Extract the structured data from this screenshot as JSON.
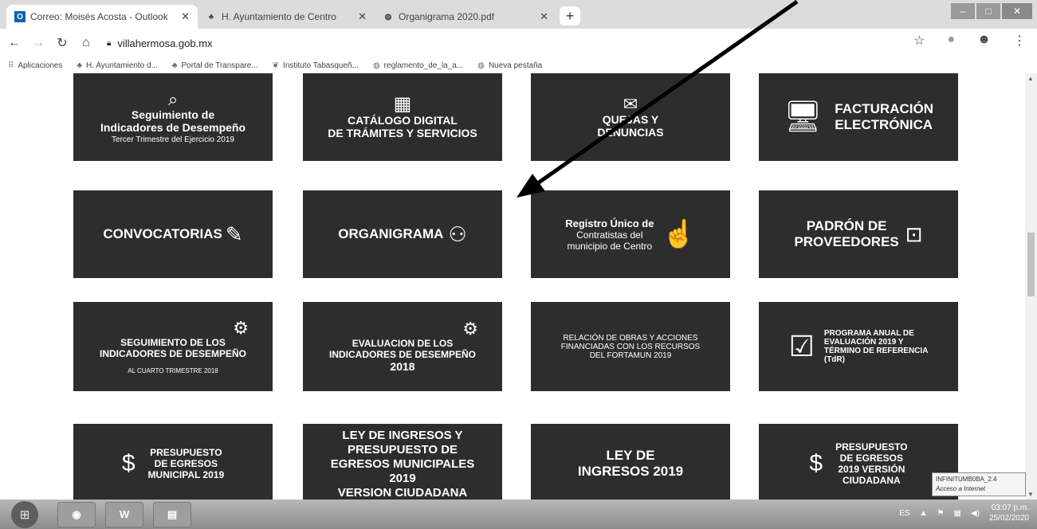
{
  "browser": {
    "tabs": [
      {
        "title": "Correo: Moisés Acosta - Outlook",
        "favicon": "outlook-icon",
        "active": true
      },
      {
        "title": "H. Ayuntamiento de Centro",
        "favicon": "palm-icon",
        "active": false
      },
      {
        "title": "Organigrama 2020.pdf",
        "favicon": "globe-icon",
        "active": false
      }
    ],
    "new_tab_label": "+",
    "url": "villahermosa.gob.mx",
    "bookmarks": [
      {
        "label": "Aplicaciones",
        "icon": "apps-grid-icon"
      },
      {
        "label": "H. Ayuntamiento d...",
        "icon": "palm-icon"
      },
      {
        "label": "Portal de Transpare...",
        "icon": "palm-icon"
      },
      {
        "label": "Instituto Tabasqueñ...",
        "icon": "leaf-icon"
      },
      {
        "label": "reglamento_de_la_a...",
        "icon": "globe-icon"
      },
      {
        "label": "Nueva pestaña",
        "icon": "globe-icon"
      }
    ]
  },
  "tiles": {
    "r1": {
      "seguimiento": {
        "line1": "Seguimiento de",
        "line2": "Indicadores de Desempeño",
        "line3": "Tercer Trimestre del Ejercicio 2019"
      },
      "catalogo": {
        "line1": "CATÁLOGO DIGITAL",
        "line2": "DE TRÁMITES Y SERVICIOS"
      },
      "quejas": {
        "line1": "QUEJAS Y",
        "line2": "DENUNCIAS"
      },
      "facturacion": {
        "line1": "FACTURACIÓN",
        "line2": "ELECTRÓNICA"
      }
    },
    "r2": {
      "convocatorias": {
        "label": "CONVOCATORIAS"
      },
      "organigrama": {
        "label": "ORGANIGRAMA"
      },
      "registro": {
        "line1": "Registro Único de",
        "line2": "Contratistas del",
        "line3": "municipio de Centro"
      },
      "padron": {
        "line1": "PADRÓN DE",
        "line2": "PROVEEDORES"
      }
    },
    "r3": {
      "seguimiento_ind": {
        "line1": "SEGUIMIENTO DE LOS",
        "line2": "INDICADORES DE DESEMPEÑO",
        "line3": "AL CUARTO TRIMESTRE 2018"
      },
      "evaluacion": {
        "line1": "EVALUACION DE LOS",
        "line2": "INDICADORES DE DESEMPEÑO",
        "line3": "2018"
      },
      "relacion": {
        "line1": "RELACIÓN DE OBRAS Y ACCIONES",
        "line2": "FINANCIADAS CON LOS RECURSOS",
        "line3": "DEL FORTAMUN 2019"
      },
      "programa": {
        "line1": "PROGRAMA ANUAL DE",
        "line2": "EVALUACIÓN 2019 Y",
        "line3": "TÉRMINO DE REFERENCIA",
        "line4": "(TdR)"
      }
    },
    "r4": {
      "presupuesto": {
        "line1": "PRESUPUESTO",
        "line2": "DE EGRESOS",
        "line3": "MUNICIPAL 2019"
      },
      "ley_ingresos_presupuesto": {
        "line1": "LEY DE INGRESOS Y",
        "line2": "PRESUPUESTO DE",
        "line3": "EGRESOS MUNICIPALES",
        "line4": "2019",
        "line5": "VERSION CIUDADANA"
      },
      "ley_ingresos": {
        "line1": "LEY DE",
        "line2": "INGRESOS 2019"
      },
      "presupuesto_ciudadana": {
        "line1": "PRESUPUESTO",
        "line2": "DE EGRESOS",
        "line3": "2019 VERSIÓN",
        "line4": "CIUDADANA"
      }
    }
  },
  "tooltip": {
    "line1": "INFINITUMB0BA_2.4",
    "line2": "Acceso a Internet"
  },
  "taskbar": {
    "word_label": "W",
    "lang": "ES",
    "time": "03:07 p.m.",
    "date": "25/02/2020"
  },
  "colors": {
    "tile_bg": "#2d2d2d",
    "arrow": "#000000"
  }
}
